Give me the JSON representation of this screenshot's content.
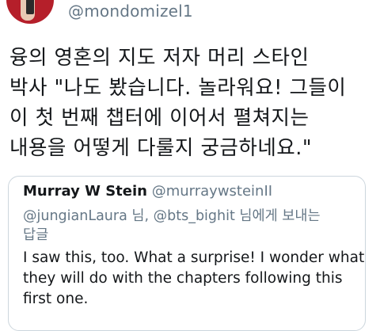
{
  "author": {
    "handle": "@mondomizel1"
  },
  "tweet": {
    "lines": [
      "융의 영혼의 지도 저자 머리 스타인",
      "박사 \"나도 봤습니다. 놀라워요! 그들이",
      "이 첫 번째 챕터에 이어서 펼쳐지는",
      "내용을 어떻게 다룰지 궁금하네요.\""
    ]
  },
  "quoted_tweet": {
    "name": "Murray W Stein",
    "handle": "@murraywsteinII",
    "reply_line1": "@jungianLaura 님, @bts_bighit 님에게 보내는",
    "reply_line2": "답글",
    "text_lines": [
      "I saw this, too. What a surprise! I wonder what",
      "they will do with the chapters following this",
      "first one."
    ]
  },
  "colors": {
    "text": "#14171a",
    "muted": "#657786",
    "border": "#ccd6dd",
    "avatar_bg": "#b51f2a"
  }
}
